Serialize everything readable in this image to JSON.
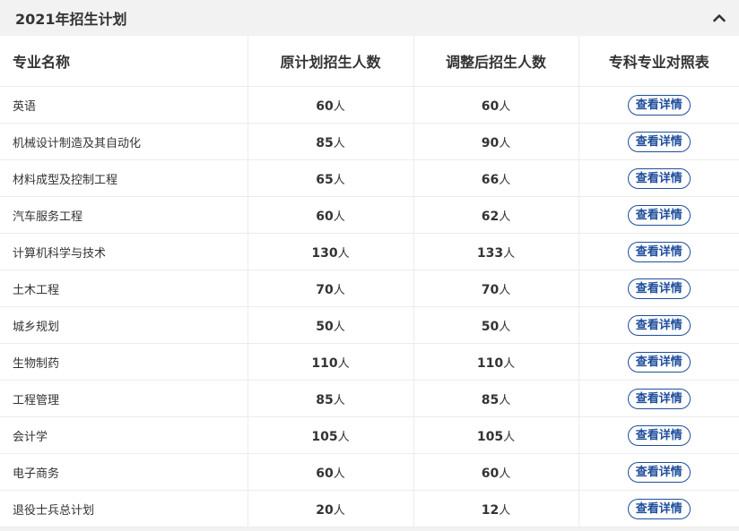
{
  "panel": {
    "title": "2021年招生计划",
    "collapse_icon": "chevron-up-icon"
  },
  "table": {
    "headers": [
      "专业名称",
      "原计划招生人数",
      "调整后招生人数",
      "专科专业对照表"
    ],
    "unit": "人",
    "rows": [
      {
        "name": "英语",
        "planned": "60",
        "adjusted": "60",
        "action": "查看详情"
      },
      {
        "name": "机械设计制造及其自动化",
        "planned": "85",
        "adjusted": "90",
        "action": "查看详情"
      },
      {
        "name": "材料成型及控制工程",
        "planned": "65",
        "adjusted": "66",
        "action": "查看详情"
      },
      {
        "name": "汽车服务工程",
        "planned": "60",
        "adjusted": "62",
        "action": "查看详情"
      },
      {
        "name": "计算机科学与技术",
        "planned": "130",
        "adjusted": "133",
        "action": "查看详情"
      },
      {
        "name": "土木工程",
        "planned": "70",
        "adjusted": "70",
        "action": "查看详情"
      },
      {
        "name": "城乡规划",
        "planned": "50",
        "adjusted": "50",
        "action": "查看详情"
      },
      {
        "name": "生物制药",
        "planned": "110",
        "adjusted": "110",
        "action": "查看详情"
      },
      {
        "name": "工程管理",
        "planned": "85",
        "adjusted": "85",
        "action": "查看详情"
      },
      {
        "name": "会计学",
        "planned": "105",
        "adjusted": "105",
        "action": "查看详情"
      },
      {
        "name": "电子商务",
        "planned": "60",
        "adjusted": "60",
        "action": "查看详情"
      },
      {
        "name": "退役士兵总计划",
        "planned": "20",
        "adjusted": "12",
        "action": "查看详情"
      }
    ]
  },
  "colors": {
    "accent": "#1f4e9c",
    "header_bg": "#f2f2f2",
    "border": "#ececec"
  }
}
